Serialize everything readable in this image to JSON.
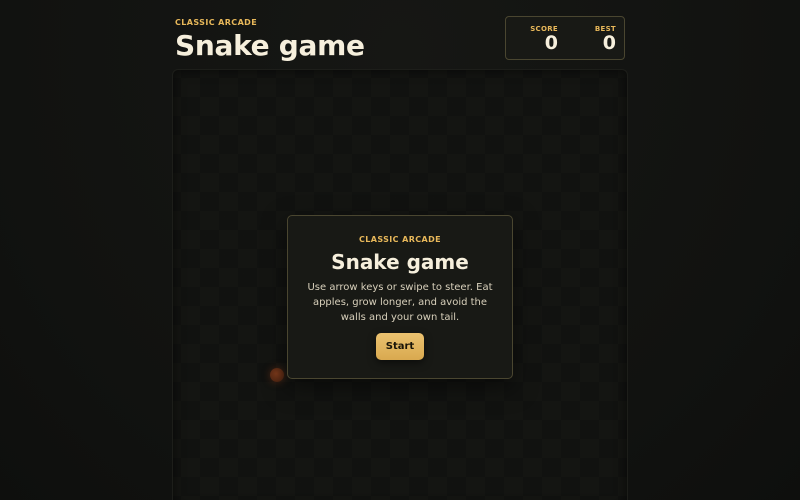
{
  "header": {
    "eyebrow": "CLASSIC ARCADE",
    "title": "Snake game"
  },
  "scoreboard": {
    "score_label": "SCORE",
    "score_value": "0",
    "best_label": "BEST",
    "best_value": "0"
  },
  "modal": {
    "eyebrow": "CLASSIC ARCADE",
    "title": "Snake game",
    "description": "Use arrow keys or swipe to steer. Eat apples, grow longer, and avoid the walls and your own tail.",
    "start_label": "Start"
  },
  "colors": {
    "accent": "#e8b85a",
    "background": "#121311",
    "apple": "#6a3118"
  }
}
